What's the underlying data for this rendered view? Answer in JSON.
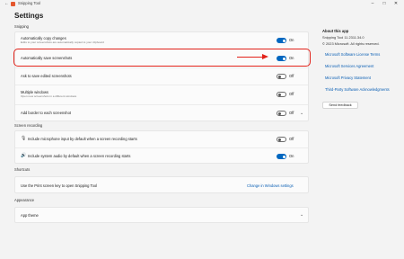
{
  "titlebar": {
    "back": "←",
    "title": "Snipping Tool",
    "minimize": "–",
    "maximize": "□",
    "close": "✕"
  },
  "page_title": "Settings",
  "sections": {
    "snipping": "Snipping",
    "screen_recording": "Screen recording",
    "shortcuts": "Shortcuts",
    "appearance": "Appearance"
  },
  "snipping": {
    "copy_changes": {
      "title": "Automatically copy changes",
      "desc": "Edits to your screenshots are automatically copied to your clipboard",
      "state": "On"
    },
    "save_screenshots": {
      "title": "Automatically save screenshots",
      "state": "On"
    },
    "ask_save_edited": {
      "title": "Ask to save edited screenshots",
      "state": "Off"
    },
    "multiple_windows": {
      "title": "Multiple windows",
      "desc": "Open new screenshots in a different windows",
      "state": "Off"
    },
    "add_border": {
      "title": "Add border to each screenshot",
      "state": "Off"
    }
  },
  "recording": {
    "microphone": {
      "title": "Include microphone input by default when a screen recording starts",
      "state": "Off"
    },
    "system_audio": {
      "title": "Include system audio by default when a screen recording starts",
      "state": "On"
    }
  },
  "shortcuts": {
    "print_screen": "Use the Print screen key to open Snipping Tool",
    "change_link": "Change in Windows settings"
  },
  "appearance": {
    "app_theme": "App theme"
  },
  "about": {
    "title": "About this app",
    "version": "Snipping Tool 11.2311.34.0",
    "copyright": "© 2023 Microsoft. All rights reserved.",
    "links": [
      "Microsoft Software License Terms",
      "Microsoft Services Agreement",
      "Microsoft Privacy Statement",
      "Third-Party Software Acknowledgments"
    ],
    "feedback": "Send feedback"
  },
  "colors": {
    "accent": "#0067c0",
    "annotation": "#e2231a",
    "background": "#f3f3f3"
  }
}
